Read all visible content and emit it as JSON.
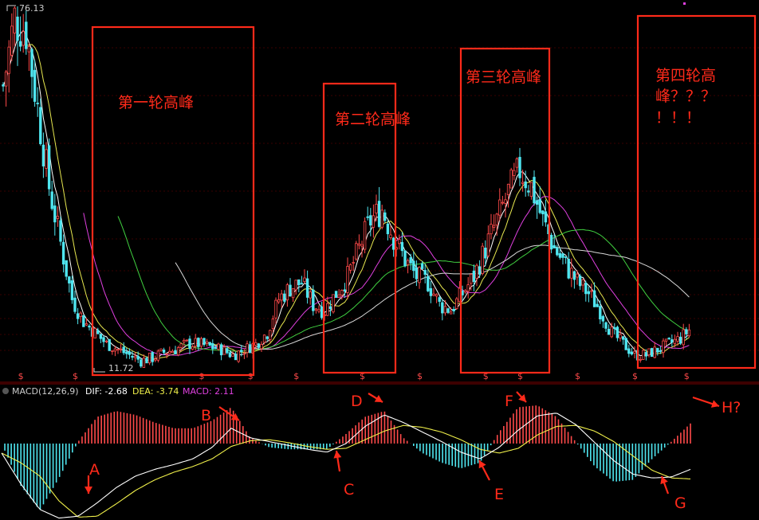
{
  "top_price_label": "76.13",
  "low_price_label": "11.72",
  "macd_header": {
    "name": "MACD(12,26,9)",
    "dif_label": "DIF: -2.68",
    "dea_label": "DEA: -3.74",
    "macd_label": "MACD: 2.11"
  },
  "peaks": [
    {
      "label": "第一轮高峰"
    },
    {
      "label": "第二轮高峰"
    },
    {
      "label": "第三轮高峰"
    },
    {
      "label_line1": "第四轮高",
      "label_line2": "峰？？？",
      "label_line3": "！！！"
    }
  ],
  "markers": [
    "A",
    "B",
    "C",
    "D",
    "E",
    "F",
    "G",
    "H?"
  ],
  "event_marker": "$",
  "colors": {
    "up": "#ff4a4a",
    "down": "#4fe6f0",
    "annotation": "#ff2a1a",
    "dif": "#ffffff",
    "dea": "#f0f04a",
    "ma_magenta": "#e040e0",
    "ma_green": "#40d040",
    "ma_long": "#d8d8d8",
    "ma_yellow": "#e8e850",
    "grid": "#3a0000"
  },
  "chart_data": [
    {
      "type": "candlestick",
      "title": "",
      "ylim": [
        11.72,
        76.13
      ],
      "annotations": [
        "第一轮高峰",
        "第二轮高峰",
        "第三轮高峰",
        "第四轮高峰？？？！！！"
      ],
      "high_label": 76.13,
      "low_label": 11.72,
      "price_path": [
        [
          0,
          62
        ],
        [
          4,
          74
        ],
        [
          8,
          72
        ],
        [
          12,
          58
        ],
        [
          16,
          44
        ],
        [
          20,
          34
        ],
        [
          24,
          24
        ],
        [
          28,
          20
        ],
        [
          32,
          18
        ],
        [
          36,
          16
        ],
        [
          40,
          15
        ],
        [
          44,
          14
        ],
        [
          48,
          13
        ],
        [
          52,
          13.5
        ],
        [
          56,
          14.5
        ],
        [
          60,
          15
        ],
        [
          64,
          16
        ],
        [
          68,
          16
        ],
        [
          72,
          15.5
        ],
        [
          76,
          15
        ],
        [
          80,
          14
        ],
        [
          84,
          15
        ],
        [
          88,
          16
        ],
        [
          92,
          18
        ],
        [
          96,
          24
        ],
        [
          100,
          26
        ],
        [
          104,
          27
        ],
        [
          108,
          23
        ],
        [
          112,
          22
        ],
        [
          116,
          25
        ],
        [
          120,
          28
        ],
        [
          124,
          33
        ],
        [
          128,
          38
        ],
        [
          132,
          40
        ],
        [
          136,
          35
        ],
        [
          140,
          31
        ],
        [
          144,
          28
        ],
        [
          148,
          27
        ],
        [
          152,
          23
        ],
        [
          156,
          22
        ],
        [
          160,
          25
        ],
        [
          164,
          28
        ],
        [
          168,
          33
        ],
        [
          172,
          38
        ],
        [
          176,
          43
        ],
        [
          180,
          47
        ],
        [
          184,
          44
        ],
        [
          188,
          38
        ],
        [
          192,
          33
        ],
        [
          196,
          30
        ],
        [
          200,
          27
        ],
        [
          204,
          25
        ],
        [
          208,
          22
        ],
        [
          212,
          18
        ],
        [
          216,
          16
        ],
        [
          220,
          14
        ],
        [
          224,
          14
        ],
        [
          228,
          15
        ],
        [
          232,
          16
        ],
        [
          236,
          17
        ],
        [
          240,
          19
        ]
      ]
    },
    {
      "type": "line",
      "title": "MACD(12,26,9)",
      "series": [
        {
          "name": "DIF",
          "values": [
            -1.0,
            -4.2,
            -6.9,
            -7.8,
            -7.6,
            -6.2,
            -4.6,
            -3.4,
            -2.7,
            -2.2,
            -1.6,
            -0.4,
            1.6,
            0.6,
            0.2,
            -0.2,
            -0.6,
            -0.9,
            0.0,
            1.8,
            3.0,
            2.2,
            1.2,
            0.2,
            -0.9,
            -1.6,
            -0.4,
            1.4,
            2.9,
            3.2,
            2.0,
            0.1,
            -1.8,
            -3.2,
            -3.6,
            -3.5,
            -2.7
          ]
        },
        {
          "name": "DEA",
          "values": [
            -1.0,
            -2.0,
            -3.4,
            -6.0,
            -7.7,
            -7.6,
            -6.3,
            -4.9,
            -3.8,
            -3.0,
            -2.4,
            -1.6,
            -0.3,
            0.3,
            0.4,
            0.1,
            -0.3,
            -0.6,
            -0.5,
            0.4,
            1.3,
            1.9,
            1.7,
            1.2,
            0.4,
            -0.6,
            -1.0,
            -0.5,
            0.9,
            1.8,
            1.9,
            1.3,
            0.2,
            -1.3,
            -2.8,
            -3.6,
            -3.7
          ]
        },
        {
          "name": "MACD",
          "values": [
            0.0,
            -4.4,
            -7.0,
            -3.6,
            0.2,
            2.8,
            3.4,
            3.0,
            2.2,
            1.6,
            1.6,
            2.4,
            3.8,
            0.6,
            -0.4,
            -0.6,
            -0.6,
            -0.6,
            1.0,
            2.8,
            3.4,
            0.6,
            -1.0,
            -2.0,
            -2.6,
            -2.0,
            1.2,
            3.8,
            4.0,
            2.8,
            0.2,
            -2.4,
            -4.0,
            -3.8,
            -1.6,
            0.2,
            2.1
          ]
        }
      ]
    }
  ]
}
